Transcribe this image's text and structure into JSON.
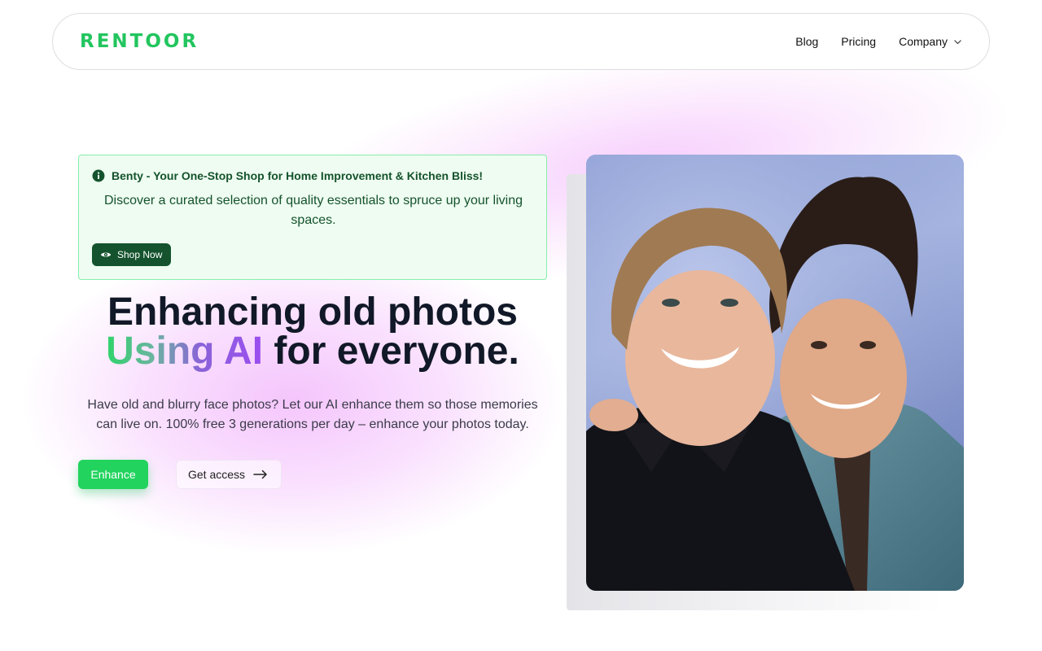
{
  "nav": {
    "logo": "RENTOOR",
    "links": [
      {
        "label": "Blog"
      },
      {
        "label": "Pricing"
      },
      {
        "label": "Company",
        "icon": "chevron-down-icon"
      }
    ]
  },
  "alert": {
    "icon": "info-icon",
    "title": "Benty - Your One-Stop Shop for Home Improvement & Kitchen Bliss!",
    "body": "Discover a curated selection of quality essentials to spruce up your living spaces.",
    "button": {
      "label": "Shop Now",
      "icon": "eye-icon"
    }
  },
  "hero": {
    "headline_line1": "Enhancing old photos",
    "headline_gradient": "Using AI",
    "headline_rest": " for everyone.",
    "description": "Have old and blurry face photos? Let our AI enhance them so those memories can live on. 100% free 3 generations per day – enhance your photos today.",
    "primary_button": "Enhance",
    "secondary_button": "Get access",
    "secondary_icon": "arrow-right-icon"
  },
  "colors": {
    "brand": "#22c55e",
    "alert_bg": "#effcf1",
    "alert_text": "#14532d",
    "glow": "#f0a8fc",
    "gradient_start": "#2fd46a",
    "gradient_end": "#9b4ef0"
  }
}
